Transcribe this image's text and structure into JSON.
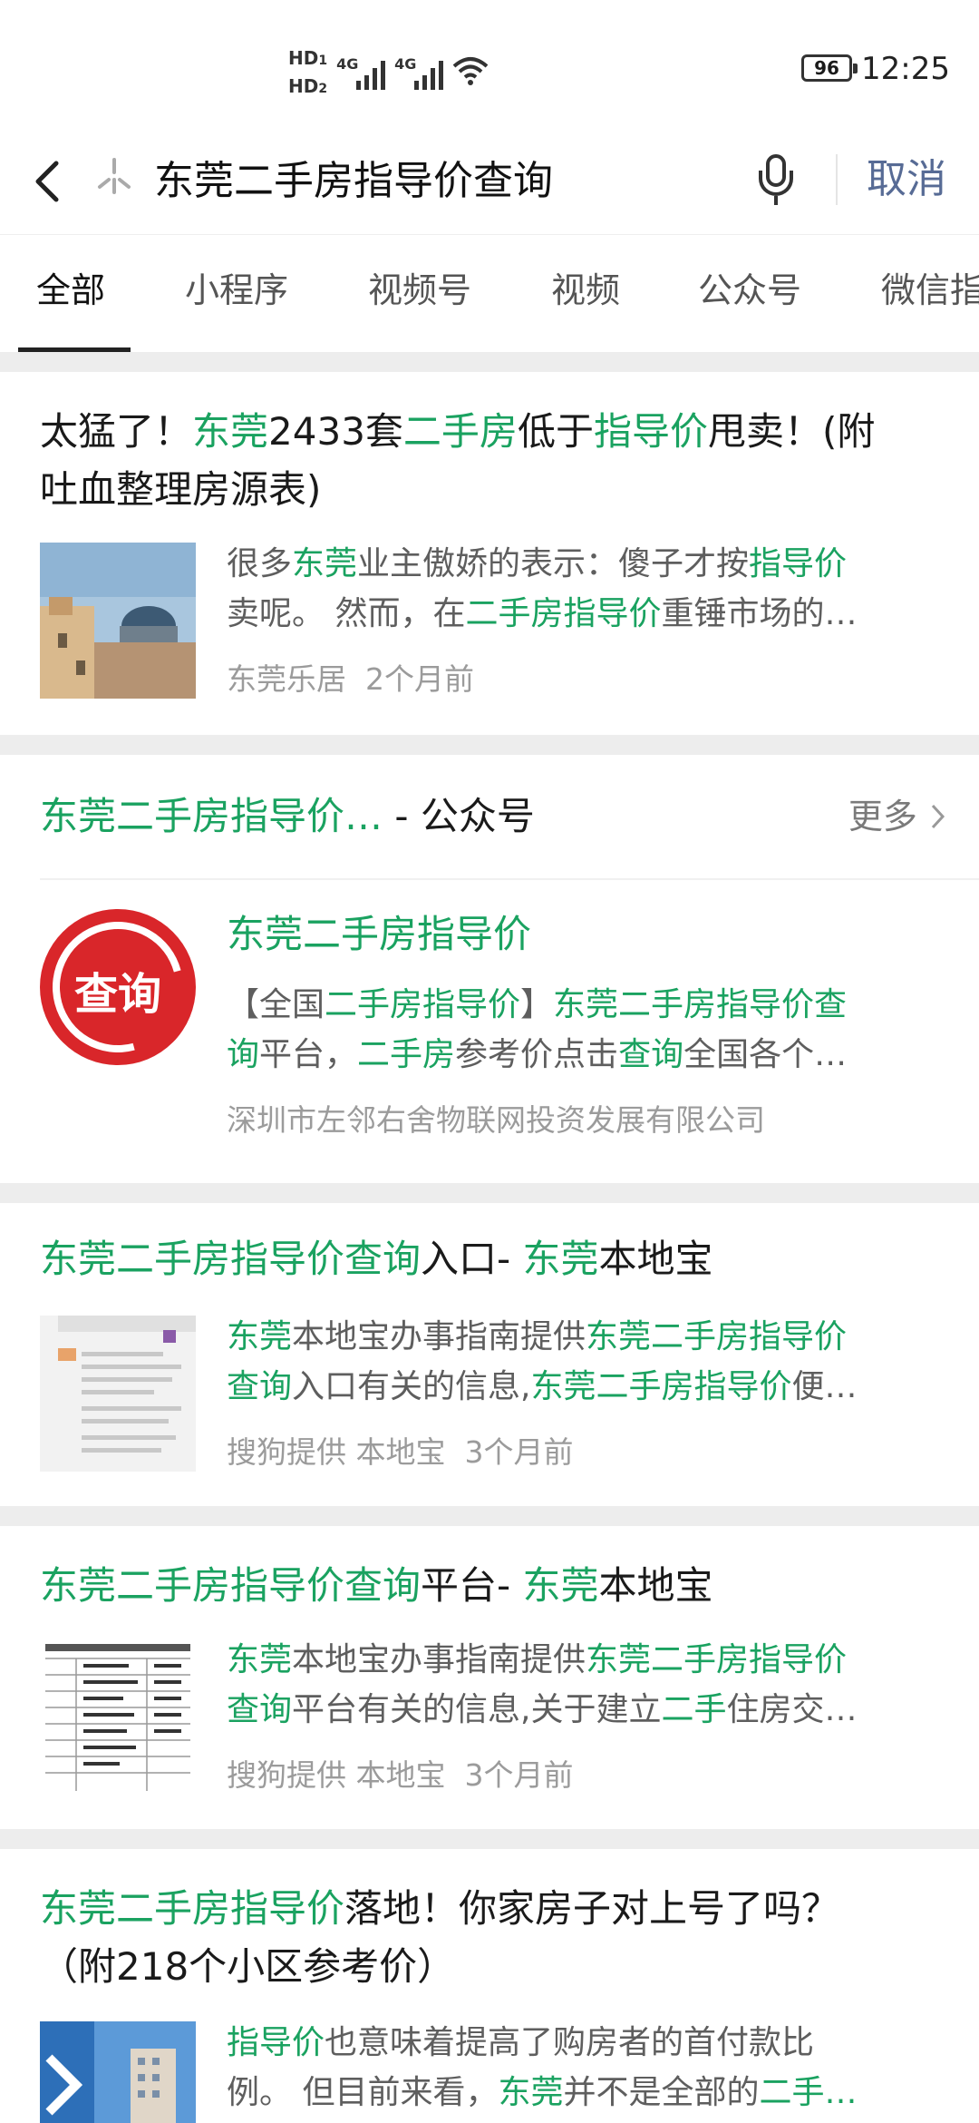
{
  "status": {
    "hd1": "HD",
    "hd1_sub": "1",
    "hd2": "HD",
    "hd2_sub": "2",
    "net1": "4G",
    "net2": "4G",
    "battery": "96",
    "time": "12:25"
  },
  "search": {
    "query": "东莞二手房指导价查询",
    "cancel": "取消"
  },
  "tabs": [
    "全部",
    "小程序",
    "视频号",
    "视频",
    "公众号",
    "微信指"
  ],
  "colors": {
    "highlight": "#1aa260",
    "cancel": "#576b95",
    "logo_red": "#d9262a"
  },
  "results": [
    {
      "title_parts": [
        "太猛了！",
        "东莞",
        "2433套",
        "二手房",
        "低于",
        "指导价",
        "甩卖！(附",
        "吐血整理房源表)"
      ],
      "desc_line1": [
        "很多",
        "东莞",
        "业主傲娇的表示：傻子才按",
        "指导价"
      ],
      "desc_line2": [
        "卖呢。 然而，在",
        "二手房指导价",
        "重锤市场的…"
      ],
      "source": "东莞乐居",
      "time": "2个月前"
    },
    {
      "section_title": "东莞二手房指导价…",
      "section_suffix": " - 公众号",
      "more": "更多",
      "logo_text": "查询",
      "account_name": "东莞二手房指导价",
      "desc_line1": [
        "【全国",
        "二手房指导价",
        "】",
        "东莞二手房指导价查"
      ],
      "desc_line2": [
        "询",
        "平台，",
        "二手房",
        "参考价点击",
        "查询",
        "全国各个…"
      ],
      "company": "深圳市左邻右舍物联网投资发展有限公司"
    },
    {
      "title_parts": [
        "东莞二手房指导价查询",
        "入口- ",
        "东莞",
        "本地宝"
      ],
      "desc_line1": [
        "东莞",
        "本地宝办事指南提供",
        "东莞二手房指导价"
      ],
      "desc_line2": [
        "查询",
        "入口有关的信息,",
        "东莞二手房指导价",
        "便…"
      ],
      "source": "搜狗提供 本地宝",
      "time": "3个月前"
    },
    {
      "title_parts": [
        "东莞二手房指导价查询",
        "平台- ",
        "东莞",
        "本地宝"
      ],
      "desc_line1": [
        "东莞",
        "本地宝办事指南提供",
        "东莞二手房指导价"
      ],
      "desc_line2": [
        "查询",
        "平台有关的信息,关于建立",
        "二手",
        "住房交…"
      ],
      "source": "搜狗提供 本地宝",
      "time": "3个月前"
    },
    {
      "title_parts": [
        "东莞二手房指导价",
        "落地！你家房子对上号了吗？",
        "（附218个小区参考价）"
      ],
      "desc_line1": [
        "指导价",
        "也意味着提高了购房者的首付款比"
      ],
      "desc_line2": [
        "例。 但目前来看，",
        "东莞",
        "并不是全部的",
        "二手…"
      ]
    }
  ]
}
